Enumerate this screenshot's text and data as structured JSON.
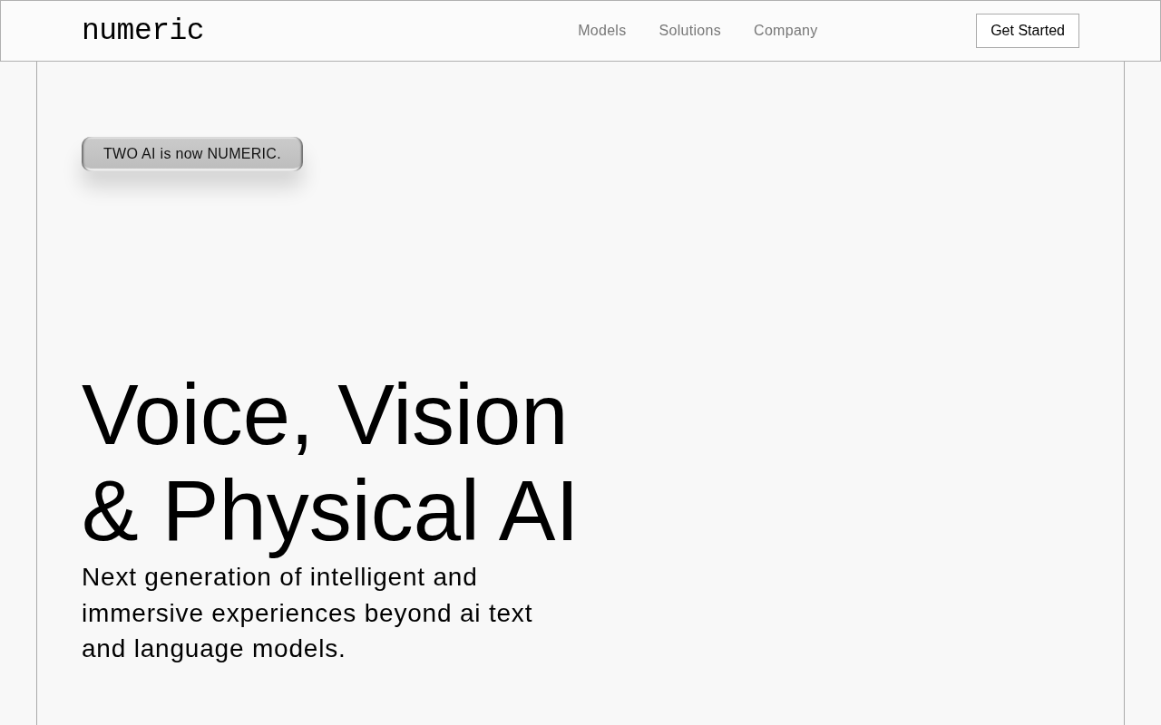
{
  "header": {
    "logo": "numeric",
    "nav": [
      {
        "label": "Models"
      },
      {
        "label": "Solutions"
      },
      {
        "label": "Company"
      }
    ],
    "cta": "Get Started"
  },
  "hero": {
    "announcement": "TWO AI is now NUMERIC.",
    "headline": "Voice, Vision & Physical AI",
    "subheadline": "Next generation of intelligent and immersive experiences beyond ai text and language models."
  }
}
